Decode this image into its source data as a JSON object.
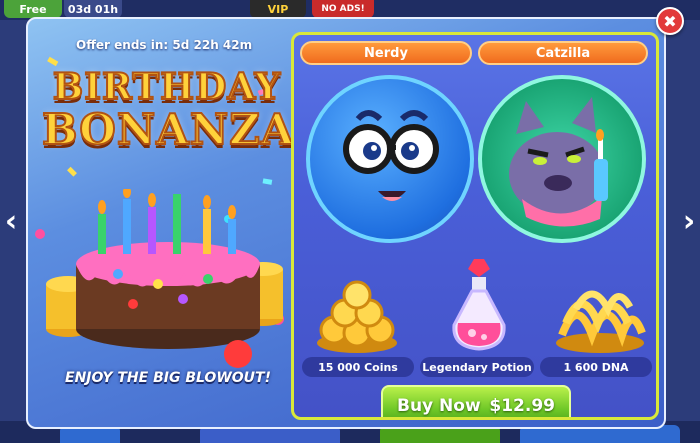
{
  "hud": {
    "free_label": "Free",
    "timer_label": "03d 01h",
    "vip_label": "VIP",
    "no_ads_label": "NO ADS!"
  },
  "offer": {
    "timer_text": "Offer ends in: 5d 22h 42m",
    "title_line1": "BIRTHDAY",
    "title_line2": "BONANZA!",
    "tagline": "ENJOY THE BIG BLOWOUT!"
  },
  "characters": [
    {
      "name": "Nerdy",
      "icon": "nerdy-blue-ball-skin"
    },
    {
      "name": "Catzilla",
      "icon": "catzilla-cat-skin"
    }
  ],
  "rewards": [
    {
      "label": "15 000 Coins",
      "icon": "coins-pile-icon"
    },
    {
      "label": "Legendary Potion",
      "icon": "pink-potion-icon"
    },
    {
      "label": "1 600 DNA",
      "icon": "dna-pile-icon"
    }
  ],
  "buy": {
    "label": "Buy Now",
    "price": "$12.99"
  },
  "close_icon": "close-icon",
  "colors": {
    "accent_orange": "#f06b1e",
    "buy_green": "#6ec727",
    "close_red": "#e23a3a",
    "title_yellow": "#ffd23b"
  }
}
